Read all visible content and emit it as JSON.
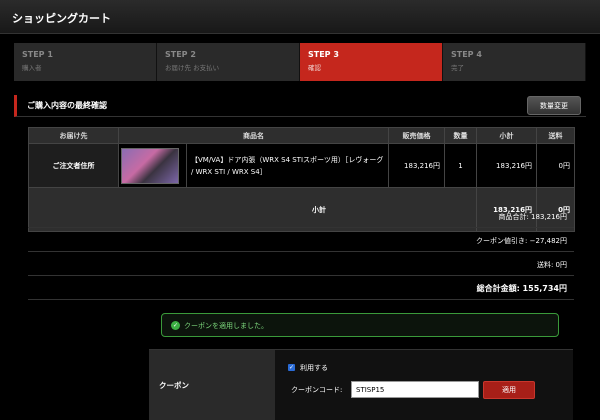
{
  "header": {
    "title": "ショッピングカート"
  },
  "steps": [
    {
      "num": "STEP 1",
      "sub": "購入者"
    },
    {
      "num": "STEP 2",
      "sub": "お届け先 お支払い"
    },
    {
      "num": "STEP 3",
      "sub": "確認"
    },
    {
      "num": "STEP 4",
      "sub": "完了"
    }
  ],
  "section": {
    "title": "ご購入内容の最終確認",
    "change_qty_label": "数量変更"
  },
  "table": {
    "headers": [
      "お届け先",
      "商品名",
      "販売価格",
      "数量",
      "小計",
      "送料"
    ],
    "row": {
      "address": "ご注文者住所",
      "product": "【VM/VA】ドア内張（WRX S4 STIスポーツ用）［レヴォーグ / WRX STI / WRX S4］",
      "price": "183,216円",
      "qty": "1",
      "subtotal": "183,216円",
      "shipping": "0円"
    },
    "subtotal_row": {
      "label": "小計",
      "subtotal": "183,216円",
      "shipping": "0円"
    }
  },
  "summary": {
    "items_total": "商品合計: 183,216円",
    "coupon_discount": "クーポン値引き: −27,482円",
    "shipping": "送料: 0円",
    "grand_total": "総合計金額: 155,734円"
  },
  "notice": {
    "message": "クーポンを適用しました。"
  },
  "coupon": {
    "label": "クーポン",
    "use_label": "利用する",
    "code_label": "クーポンコード:",
    "code_value": "STISP15",
    "apply_label": "適用"
  },
  "colors": {
    "accent": "#c5271d",
    "success": "#3cb043",
    "checkbox": "#2a6bd6"
  }
}
